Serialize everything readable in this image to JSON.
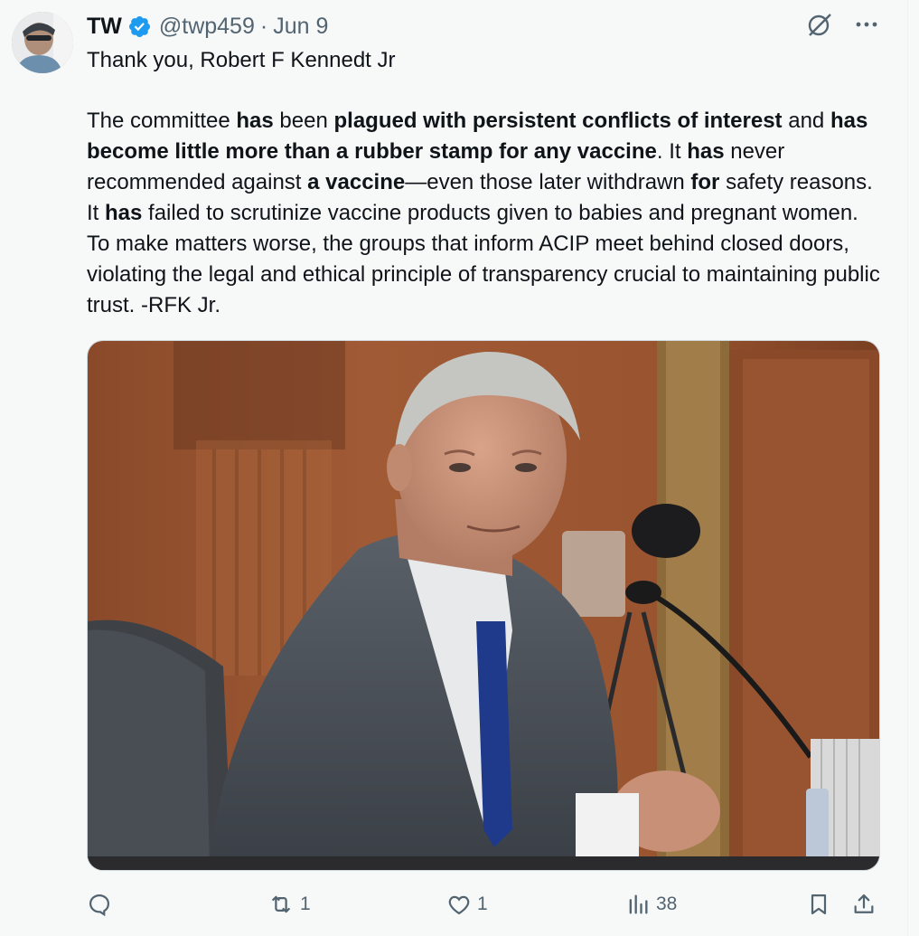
{
  "author": {
    "display_name": "TW",
    "handle": "@twp459",
    "separator": "·",
    "date": "Jun 9"
  },
  "reply_line": "Thank you, Robert F Kennedt Jr",
  "body_segments": [
    {
      "text": "The committee ",
      "bold": false
    },
    {
      "text": "has",
      "bold": true
    },
    {
      "text": " been ",
      "bold": false
    },
    {
      "text": "plagued with persistent conflicts of interest",
      "bold": true
    },
    {
      "text": " and ",
      "bold": false
    },
    {
      "text": "has become little more than a rubber stamp for any vaccine",
      "bold": true
    },
    {
      "text": ". It ",
      "bold": false
    },
    {
      "text": "has",
      "bold": true
    },
    {
      "text": " never recommended against ",
      "bold": false
    },
    {
      "text": "a vaccine",
      "bold": true
    },
    {
      "text": "—even those later withdrawn ",
      "bold": false
    },
    {
      "text": "for",
      "bold": true
    },
    {
      "text": " safety reasons. It ",
      "bold": false
    },
    {
      "text": "has",
      "bold": true
    },
    {
      "text": " failed to scrutinize vaccine products given to babies and pregnant women. To make matters worse, the groups that inform ACIP meet behind closed doors, violating the legal and ethical principle of transparency crucial to maintaining public trust. -RFK Jr.",
      "bold": false
    }
  ],
  "icons": {
    "verified": "verified-badge-icon",
    "grok": "grok-icon",
    "more": "more-icon",
    "reply": "reply-icon",
    "retweet": "retweet-icon",
    "like": "like-icon",
    "views": "views-icon",
    "bookmark": "bookmark-icon",
    "share": "share-icon"
  },
  "actions": {
    "reply_count": "",
    "retweet_count": "1",
    "like_count": "1",
    "views_count": "38"
  },
  "colors": {
    "background": "#f7f9f9",
    "text_primary": "#0f1419",
    "text_secondary": "#536471",
    "verified_blue": "#1d9bf0"
  }
}
